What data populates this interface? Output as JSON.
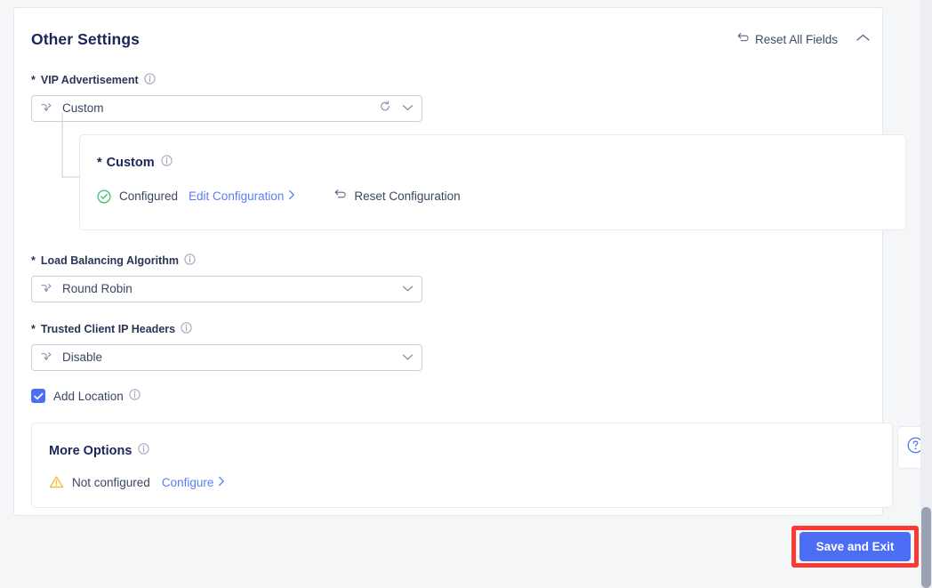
{
  "panel": {
    "title": "Other Settings",
    "reset_all_label": "Reset All Fields",
    "reset_icon": "reset-arrow-icon",
    "collapse_icon": "chevron-up-icon"
  },
  "fields": {
    "vip": {
      "label": "VIP Advertisement",
      "required_mark": "*",
      "info_icon": "info-circle-icon",
      "value": "Custom",
      "lead_icon": "branch-arrow-icon",
      "refresh_icon": "refresh-icon",
      "chevron_icon": "chevron-down-icon"
    },
    "custom_card": {
      "required_mark": "*",
      "title": "Custom",
      "info_icon": "info-circle-icon",
      "status_icon": "check-circle-icon",
      "status_text": "Configured",
      "edit_link": "Edit Configuration",
      "edit_chevron": "chevron-right-icon",
      "reset_icon": "reset-arrow-icon",
      "reset_label": "Reset Configuration"
    },
    "lb": {
      "label": "Load Balancing Algorithm",
      "required_mark": "*",
      "info_icon": "info-circle-icon",
      "value": "Round Robin",
      "lead_icon": "branch-arrow-icon",
      "chevron_icon": "chevron-down-icon"
    },
    "trusted": {
      "label": "Trusted Client IP Headers",
      "required_mark": "*",
      "info_icon": "info-circle-icon",
      "value": "Disable",
      "lead_icon": "branch-arrow-icon",
      "chevron_icon": "chevron-down-icon"
    },
    "add_location": {
      "label": "Add Location",
      "checked": true,
      "check_icon": "checkmark-icon",
      "info_icon": "info-circle-icon"
    },
    "more_options": {
      "title": "More Options",
      "info_icon": "info-circle-icon",
      "status_icon": "warning-triangle-icon",
      "status_text": "Not configured",
      "configure_link": "Configure",
      "configure_chevron": "chevron-right-icon"
    }
  },
  "footer": {
    "save_label": "Save and Exit"
  },
  "help": {
    "icon": "question-circle-icon"
  },
  "colors": {
    "accent": "#4c6ef5",
    "link": "#5b7cfa",
    "title": "#1b2559",
    "success": "#34c759",
    "warning": "#f5b731",
    "highlight": "#fb3a34",
    "page_bg": "#f5f6f8"
  }
}
